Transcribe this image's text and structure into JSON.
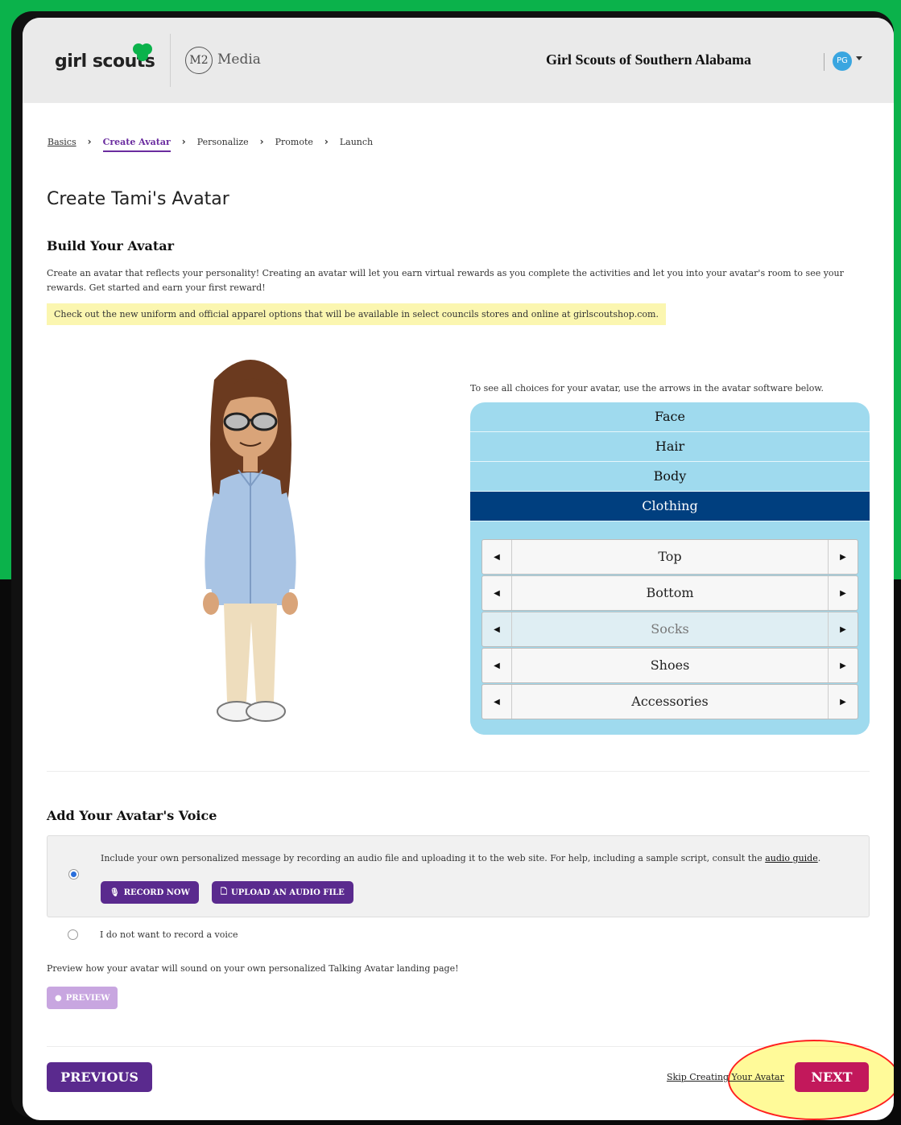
{
  "header": {
    "logo_text": "girl scouts",
    "partner_badge": "M2",
    "partner_text": "Media",
    "council_name": "Girl Scouts of Southern Alabama",
    "user_initials": "PG"
  },
  "breadcrumbs": [
    {
      "label": "Basics",
      "state": "link"
    },
    {
      "label": "Create Avatar",
      "state": "active"
    },
    {
      "label": "Personalize",
      "state": "normal"
    },
    {
      "label": "Promote",
      "state": "normal"
    },
    {
      "label": "Launch",
      "state": "normal"
    }
  ],
  "page": {
    "title": "Create Tami's Avatar"
  },
  "build": {
    "heading": "Build Your Avatar",
    "intro": "Create an avatar that reflects your personality! Creating an avatar will let you earn virtual rewards as you complete the activities and let you into your avatar's room to see your rewards. Get started and earn your first reward!",
    "notice": "Check out the new uniform and official apparel options that will be available in select councils stores and online at girlscoutshop.com."
  },
  "picker": {
    "hint": "To see all choices for your avatar, use the arrows in the avatar software below.",
    "tabs": [
      "Face",
      "Hair",
      "Body",
      "Clothing"
    ],
    "active_tab": "Clothing",
    "parts": [
      "Top",
      "Bottom",
      "Socks",
      "Shoes",
      "Accessories"
    ],
    "dimmed_part": "Socks"
  },
  "voice": {
    "heading": "Add Your Avatar's Voice",
    "option_record_text": "Include your own personalized message by recording an audio file and uploading it to the web site. For help, including a sample script, consult the",
    "audio_guide_link": "audio guide",
    "record_label": "RECORD NOW",
    "upload_label": "UPLOAD AN AUDIO FILE",
    "option_none_text": "I do not want to record a voice",
    "preview_text": "Preview how your avatar will sound on your own personalized Talking Avatar landing page!",
    "preview_label": "PREVIEW",
    "selected_option": "record"
  },
  "footer": {
    "previous_label": "PREVIOUS",
    "skip_label": "Skip Creating Your Avatar",
    "next_label": "NEXT"
  },
  "colors": {
    "brand_purple": "#5a2a8e",
    "next_magenta": "#c2185b",
    "picker_blue": "#9fdaee",
    "active_tab_navy": "#003f7f",
    "notice_yellow": "#fbf6b0",
    "outer_green": "#0bb24b"
  },
  "icons": {
    "trefoil": "trefoil-icon",
    "record": "microphone-icon",
    "upload": "file-icon",
    "preview": "play-circle-icon",
    "left": "arrow-left-icon",
    "right": "arrow-right-icon"
  }
}
